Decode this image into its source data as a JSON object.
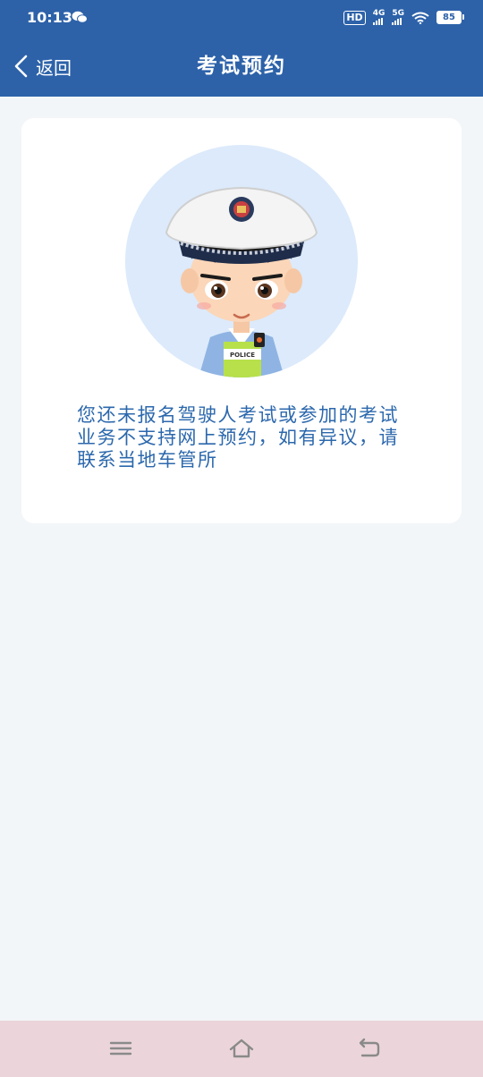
{
  "status_bar": {
    "time": "10:13",
    "hd_label": "HD",
    "network_1": "4G",
    "network_2": "5G",
    "battery": "85",
    "icons": [
      "wechat-icon",
      "hd-icon",
      "signal-4g-icon",
      "signal-5g-icon",
      "wifi-icon",
      "battery-icon"
    ]
  },
  "header": {
    "back_label": "返回",
    "title": "考试预约"
  },
  "card": {
    "badge_text": "POLICE",
    "message": "您还未报名驾驶人考试或参加的考试业务不支持网上预约，如有异议，请联系当地车管所"
  },
  "nav_bar": {
    "icons": [
      "menu-icon",
      "home-icon",
      "back-icon"
    ]
  },
  "colors": {
    "primary": "#2d62a9",
    "background": "#f3f6f8",
    "card": "#ffffff",
    "message_text": "#2c68ad",
    "nav_bar": "#ebd5da"
  }
}
